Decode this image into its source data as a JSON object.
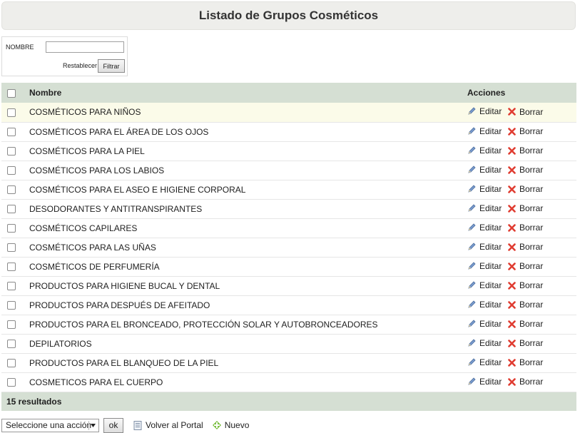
{
  "page": {
    "title": "Listado de Grupos Cosméticos"
  },
  "filter": {
    "name_label": "NOMBRE",
    "name_value": "",
    "reset_label": "Restablecer",
    "filter_button": "Filtrar"
  },
  "table": {
    "headers": {
      "name": "Nombre",
      "actions": "Acciones"
    },
    "edit_label": "Editar",
    "delete_label": "Borrar",
    "rows": [
      {
        "name": "COSMÉTICOS PARA NIÑOS"
      },
      {
        "name": "COSMÉTICOS PARA EL ÁREA DE LOS OJOS"
      },
      {
        "name": "COSMÉTICOS PARA LA PIEL"
      },
      {
        "name": "COSMÉTICOS PARA LOS LABIOS"
      },
      {
        "name": "COSMÉTICOS PARA EL ASEO E HIGIENE CORPORAL"
      },
      {
        "name": "DESODORANTES Y ANTITRANSPIRANTES"
      },
      {
        "name": "COSMÉTICOS CAPILARES"
      },
      {
        "name": "COSMÉTICOS PARA LAS UÑAS"
      },
      {
        "name": "COSMÉTICOS DE PERFUMERÍA"
      },
      {
        "name": "PRODUCTOS PARA HIGIENE BUCAL Y DENTAL"
      },
      {
        "name": "PRODUCTOS PARA DESPUÉS DE AFEITADO"
      },
      {
        "name": "PRODUCTOS PARA EL BRONCEADO, PROTECCIÓN SOLAR Y AUTOBRONCEADORES"
      },
      {
        "name": "DEPILATORIOS"
      },
      {
        "name": "PRODUCTOS PARA EL BLANQUEO DE LA PIEL"
      },
      {
        "name": "COSMETICOS PARA EL CUERPO"
      }
    ],
    "result_count": "15 resultados"
  },
  "bottom": {
    "action_select": "Seleccione una acción",
    "ok_button": "ok",
    "back_link": "Volver al Portal",
    "new_link": "Nuevo"
  },
  "icons": {
    "edit": "pencil-icon",
    "delete": "red-x-icon",
    "back": "document-icon",
    "new": "green-plus-icon"
  },
  "colors": {
    "header_bg": "#d5dfd3",
    "highlight_row": "#fbfbe9",
    "delete_icon": "#e03c31",
    "new_icon": "#7cc043"
  }
}
